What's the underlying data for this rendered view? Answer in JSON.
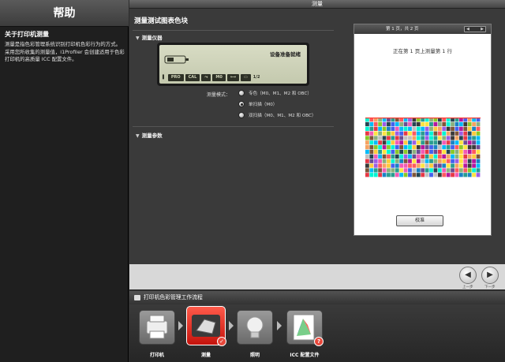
{
  "window": {
    "title": "测量"
  },
  "help": {
    "header": "帮助",
    "heading": "关于打印机测量",
    "body": "测量是指色彩管理系统识别打印机色彩行为的方式。采用您所收集的测量值，i1Profiler 会创建适用于色彩打印机的高质量 ICC 配置文件。"
  },
  "main": {
    "title": "测量测试图表色块",
    "device_section": "测量仪器",
    "lcd": {
      "status": "设备准备就绪",
      "segments": [
        "PRO",
        "CAL",
        "M0",
        "1/2"
      ]
    },
    "mode_label": "测量模式：",
    "modes": [
      {
        "label": "专色（M0、M1、M2 和 OBC）",
        "checked": false
      },
      {
        "label": "单扫描（M0）",
        "checked": true
      },
      {
        "label": "双扫描（M0、M1、M2 和 OBC）",
        "checked": false
      }
    ],
    "params_section": "测量参数",
    "params": [
      "",
      "",
      ""
    ]
  },
  "preview": {
    "header": "第 1 页，共 2 页",
    "progress": "正在第 1 页上测量第 1 行",
    "calibrate_label": "校准"
  },
  "nav": {
    "prev_label": "上一步",
    "next_label": "下一步"
  },
  "workflow": {
    "title": "打印机色彩管理工作流程",
    "steps": [
      {
        "label": "打印机",
        "icon": "printer-icon"
      },
      {
        "label": "测量",
        "icon": "spectrophotometer-icon"
      },
      {
        "label": "照明",
        "icon": "light-bulb-icon"
      },
      {
        "label": "ICC 配置文件",
        "icon": "icc-profile-icon"
      }
    ]
  },
  "colors": {
    "active_step": "#e0261c",
    "accent_row": "#ff3b30",
    "sidebar_bg": "#1f1f1f"
  },
  "chart_data": {
    "type": "heatmap",
    "rows": 13,
    "cols": 27,
    "palette": [
      "#e63946",
      "#2a9d8f",
      "#f4a261",
      "#264653",
      "#8ab17d",
      "#9b5de5",
      "#f15bb5",
      "#fee440",
      "#00bbf9",
      "#00f5d4",
      "#6a4c93",
      "#ff595e",
      "#1982c4",
      "#8ac926",
      "#ffca3a",
      "#3a3a3a",
      "#c0c0c0",
      "#7f5539",
      "#b5179e",
      "#4361ee"
    ],
    "highlight_row": 0
  }
}
